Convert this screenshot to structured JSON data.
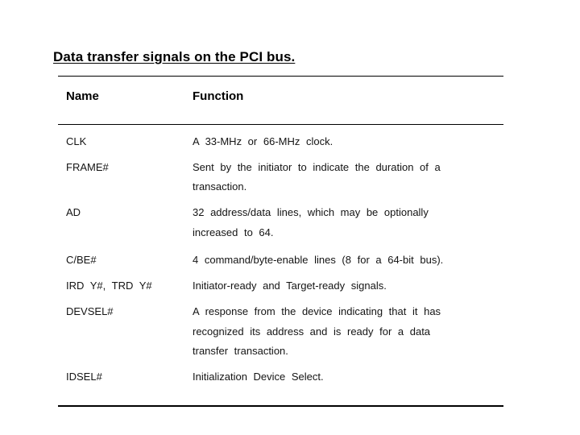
{
  "title": "Data transfer signals on the PCI bus.",
  "table": {
    "headers": {
      "name": "Name",
      "function": "Function"
    },
    "rows": [
      {
        "name": "CLK",
        "function_lines": [
          "A  33-MHz    or  66-MHz    clock."
        ]
      },
      {
        "name": "FRAME#",
        "function_lines": [
          "Sent  by  the  initiator    to  indicate   the  duration    of  a",
          "transaction."
        ]
      },
      {
        "name": "AD",
        "function_lines": [
          "32   address/data    lines,   which     may   be optionally",
          "increased    to  64."
        ]
      },
      {
        "name": "C/BE#",
        "function_lines": [
          "4  command/byte-enable      lines  (8  for   a  64-bit   bus)."
        ]
      },
      {
        "name": "IRD  Y#,     TRD  Y#",
        "function_lines": [
          "Initiator-ready      and      Target-ready  signals."
        ]
      },
      {
        "name": "DEVSEL#",
        "function_lines": [
          "A  response  from   the  device  indicating    that   it  has",
          "recognized   its  address  and  is  ready   for   a  data",
          "transfer   transaction."
        ]
      },
      {
        "name": "IDSEL#",
        "function_lines": [
          "Initialization       Device   Select."
        ]
      }
    ]
  }
}
